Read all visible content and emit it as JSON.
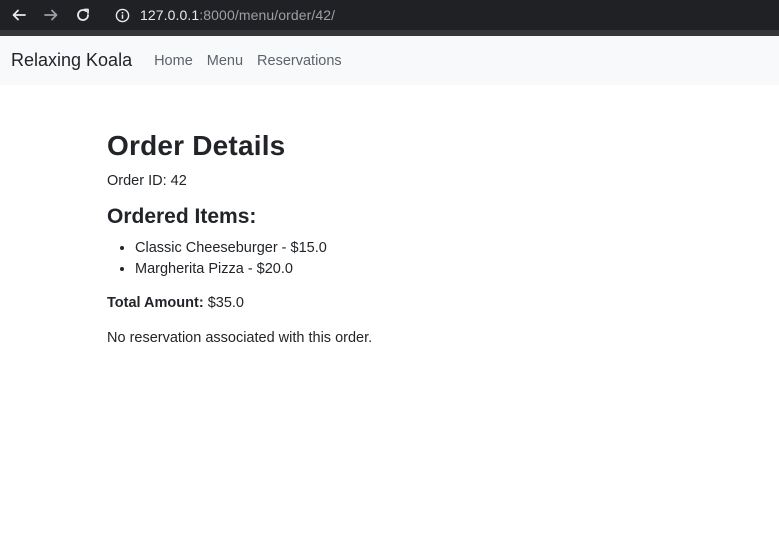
{
  "browser": {
    "url_host": "127.0.0.1",
    "url_path": ":8000/menu/order/42/"
  },
  "navbar": {
    "brand": "Relaxing Koala",
    "links": [
      "Home",
      "Menu",
      "Reservations"
    ]
  },
  "order": {
    "title": "Order Details",
    "order_id_text": "Order ID: 42",
    "items_heading": "Ordered Items:",
    "items": [
      "Classic Cheeseburger - $15.0",
      "Margherita Pizza - $20.0"
    ],
    "total_label": "Total Amount:",
    "total_value": "$35.0",
    "reservation_note": "No reservation associated with this order."
  },
  "colors": {
    "browser_bg": "#202124",
    "navbar_bg": "#f8f9fa",
    "text": "#212529",
    "nav_link": "#5c636a"
  },
  "icons": {
    "back": "arrow-left-icon",
    "forward": "arrow-right-icon",
    "reload": "reload-icon",
    "site_info": "info-icon"
  }
}
